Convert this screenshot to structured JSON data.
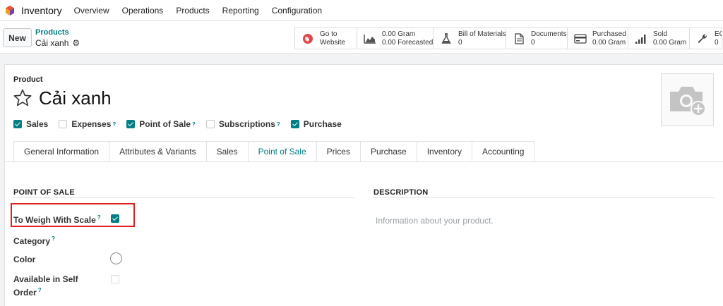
{
  "nav": {
    "app_name": "Inventory",
    "items": [
      "Overview",
      "Operations",
      "Products",
      "Reporting",
      "Configuration"
    ]
  },
  "control": {
    "new_label": "New",
    "breadcrumb_parent": "Products",
    "breadcrumb_current": "Cải xanh"
  },
  "smart_buttons": [
    {
      "icon": "globe-icon",
      "line1": "Go to",
      "line2": "Website"
    },
    {
      "icon": "area-chart-icon",
      "line1": "0.00 Gram",
      "line2": "0.00 Forecasted"
    },
    {
      "icon": "flask-icon",
      "line1": "Bill of Materials",
      "line2": "0"
    },
    {
      "icon": "document-icon",
      "line1": "Documents",
      "line2": "0"
    },
    {
      "icon": "credit-card-icon",
      "line1": "Purchased",
      "line2": "0.00 Gram"
    },
    {
      "icon": "signal-icon",
      "line1": "Sold",
      "line2": "0.00 Gram"
    },
    {
      "icon": "wrench-icon",
      "line1": "ECO",
      "line2": "0"
    }
  ],
  "form": {
    "product_label": "Product",
    "product_name": "Cải xanh",
    "checkboxes": [
      {
        "label": "Sales",
        "checked": true,
        "help": false
      },
      {
        "label": "Expenses",
        "checked": false,
        "help": true
      },
      {
        "label": "Point of Sale",
        "checked": true,
        "help": true
      },
      {
        "label": "Subscriptions",
        "checked": false,
        "help": true
      },
      {
        "label": "Purchase",
        "checked": true,
        "help": false
      }
    ],
    "help_mark": "?",
    "tabs": [
      "General Information",
      "Attributes & Variants",
      "Sales",
      "Point of Sale",
      "Prices",
      "Purchase",
      "Inventory",
      "Accounting"
    ],
    "active_tab": "Point of Sale",
    "pos_section": {
      "title": "POINT OF SALE",
      "fields": {
        "weigh_label": "To Weigh With Scale",
        "weigh_checked": true,
        "category_label": "Category",
        "color_label": "Color",
        "self_order_line1": "Available in Self",
        "self_order_line2": "Order",
        "self_order_checked": false
      }
    },
    "description_section": {
      "title": "DESCRIPTION",
      "placeholder": "Information about your product."
    }
  },
  "colors": {
    "accent": "#017e84",
    "highlight": "#e02020"
  }
}
